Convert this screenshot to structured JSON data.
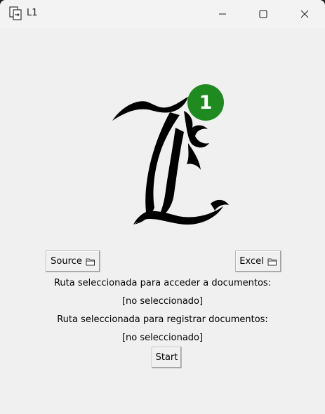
{
  "window": {
    "title": "L1",
    "app_icon": "document-transfer-icon",
    "controls": [
      "minimize-icon",
      "maximize-icon",
      "close-icon"
    ]
  },
  "logo": {
    "icon": "blackletter-l-logo",
    "badge_number": "1",
    "badge_color": "#1f8a1f"
  },
  "buttons": {
    "source_label": "Source",
    "excel_label": "Excel",
    "start_label": "Start",
    "folder_icon": "folder-icon"
  },
  "labels": {
    "access_path_label": "Ruta seleccionada para acceder a documentos:",
    "access_path_value": "[no seleccionado]",
    "register_path_label": "Ruta seleccionada para registrar documentos:",
    "register_path_value": "[no seleccionado]"
  }
}
